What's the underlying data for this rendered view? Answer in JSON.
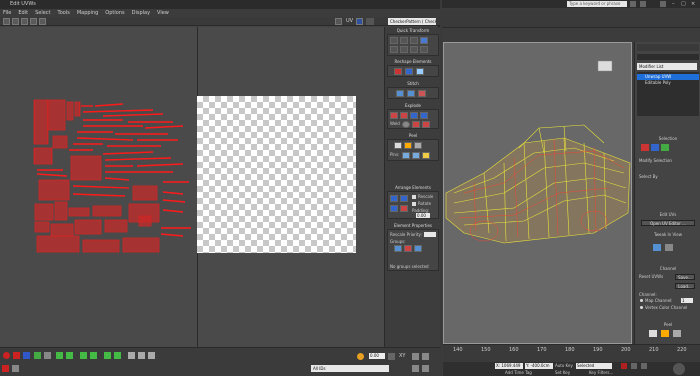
{
  "uvw": {
    "title": "Edit UVWs",
    "menu": [
      "File",
      "Edit",
      "Select",
      "Tools",
      "Mapping",
      "Options",
      "Display",
      "View"
    ],
    "uv_label": "UV",
    "checker_dropdown": "CheckerPattern ( Checker )",
    "panel": {
      "quick_transform": "Quick Transform",
      "reshape_elements": "Reshape Elements",
      "stitch": "Stitch",
      "explode": "Explode",
      "weld": "Weld",
      "peel": "Peel",
      "pins": "Pins:",
      "arrange_elements": "Arrange Elements",
      "rescale": "Rescale",
      "rotate": "Rotate",
      "padding": "Padding:",
      "padding_value": "0.00",
      "element_properties": "Element Properties",
      "rescale_priority": "Rescale Priority:",
      "groups": "Groups:",
      "no_groups": "No groups selected"
    },
    "bottom": {
      "value_field": "0.00",
      "id_dropdown": "All IDs",
      "xy_label": "XY"
    }
  },
  "max": {
    "search_placeholder": "Type a keyword or phrase",
    "modifier_list": "Modifier List",
    "stack": [
      "Unwrap UVW",
      "Editable Poly"
    ],
    "panel": {
      "selection": "Selection",
      "modify_selection": "Modify Selection",
      "select_by": "Select By",
      "edit_uvs": "Edit UVs",
      "open_uv_editor": "Open UV Editor ...",
      "tweak_in_view": "Tweak In View",
      "channel": "Channel",
      "reset_uvws": "Reset UVWs",
      "save": "Save...",
      "load": "Load...",
      "channel_label": "Channel:",
      "map_channel": "Map Channel:",
      "map_channel_value": "1",
      "vertex_color_channel": "Vertex Color Channel",
      "peel": "Peel"
    },
    "timeline_ticks": [
      "140",
      "150",
      "160",
      "170",
      "180",
      "190",
      "200",
      "210",
      "220"
    ],
    "status": {
      "add_time_tag": "Add Time Tag",
      "auto_key": "Auto Key",
      "selected": "Selected",
      "set_key": "Set Key",
      "key_filters": "Key Filters...",
      "x_value": "X: 1069.449",
      "y_value": "Y: -400.0cm"
    }
  },
  "colors": {
    "uv_red": "#ff1a1a",
    "checker_light": "#ffffff",
    "checker_dark": "#c8c8c8",
    "wire_yellow": "#e8e23a",
    "wire_red": "#ee4433",
    "panel_highlight": "#1e6fd9",
    "key_red": "#b02020"
  }
}
